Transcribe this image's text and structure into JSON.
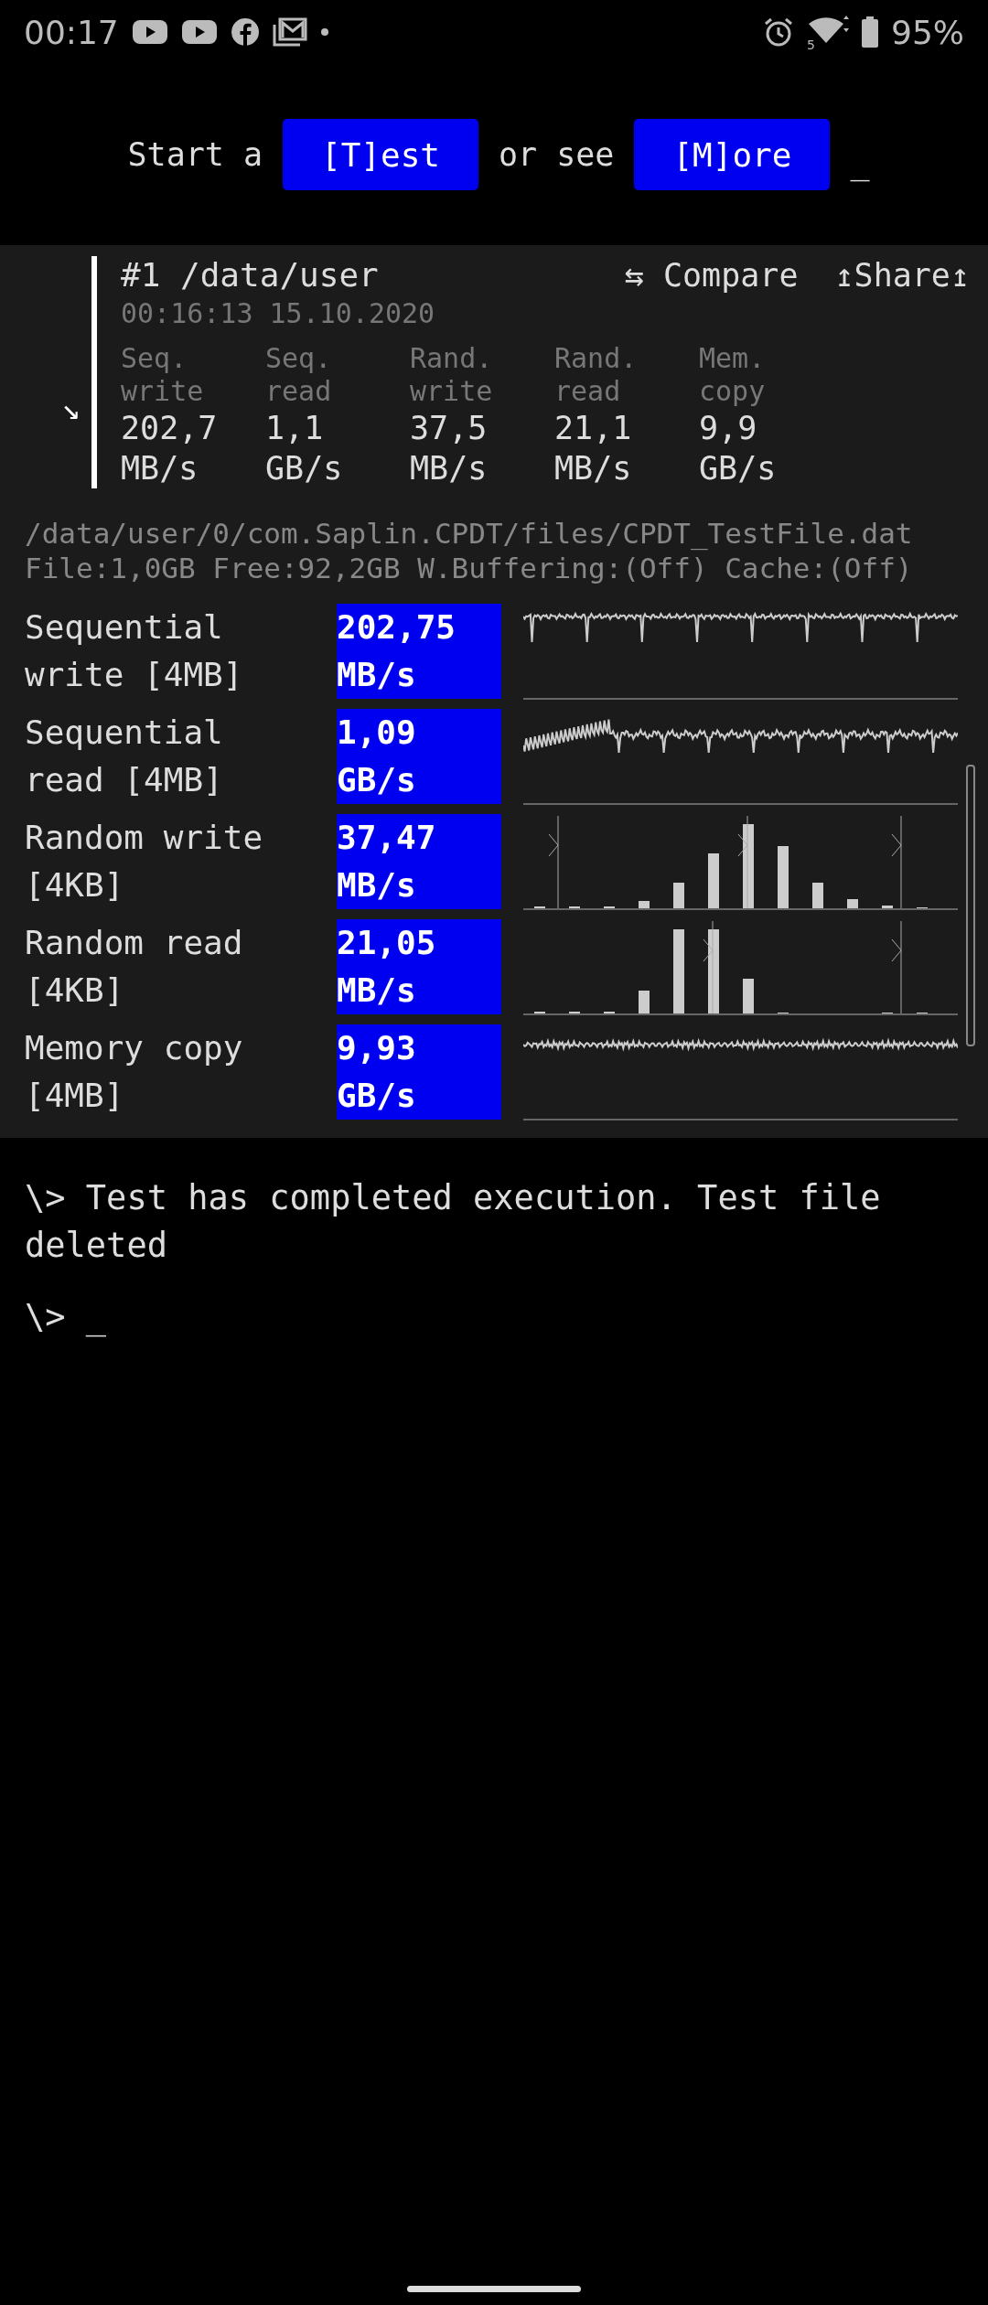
{
  "status_bar": {
    "time": "00:17",
    "network_label": "5",
    "battery": "95%"
  },
  "prompt": {
    "text_before": "Start a",
    "test_button": "[T]est",
    "text_middle": "or see",
    "more_button": "[M]ore",
    "cursor": "_"
  },
  "result": {
    "arrow": "↘",
    "title": "#1 /data/user",
    "compare": "⇆ Compare",
    "share": "↥Share↥",
    "timestamp": "00:16:13 15.10.2020",
    "metrics": [
      {
        "label": "Seq. write",
        "value": "202,7",
        "unit": "MB/s"
      },
      {
        "label": "Seq. read",
        "value": "1,1",
        "unit": "GB/s"
      },
      {
        "label": "Rand. write",
        "value": "37,5",
        "unit": "MB/s"
      },
      {
        "label": "Rand. read",
        "value": "21,1",
        "unit": "MB/s"
      },
      {
        "label": "Mem. copy",
        "value": "9,9",
        "unit": "GB/s"
      }
    ]
  },
  "file_info": {
    "path": "/data/user/0/com.Saplin.CPDT/files/CPDT_TestFile.dat",
    "stats": "File:1,0GB Free:92,2GB W.Buffering:(Off) Cache:(Off)"
  },
  "tests": [
    {
      "name": "Sequential write [4MB]",
      "value": "202,75",
      "unit": "MB/s",
      "kind": "sparkline"
    },
    {
      "name": "Sequential read [4MB]",
      "value": "1,09",
      "unit": "GB/s",
      "kind": "sparkline"
    },
    {
      "name": "Random write [4KB]",
      "value": "37,47",
      "unit": "MB/s",
      "kind": "histogram"
    },
    {
      "name": "Random read [4KB]",
      "value": "21,05",
      "unit": "MB/s",
      "kind": "histogram"
    },
    {
      "name": "Memory copy [4MB]",
      "value": "9,93",
      "unit": "GB/s",
      "kind": "sparkline"
    }
  ],
  "terminal": [
    "\\> Test has completed execution. Test file deleted",
    "\\> _"
  ]
}
